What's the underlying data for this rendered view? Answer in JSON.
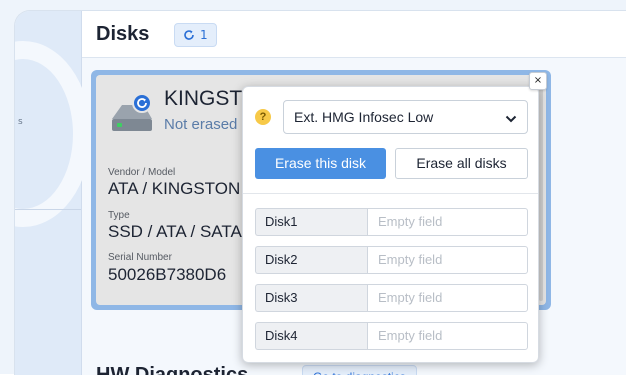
{
  "header": {
    "title": "Disks",
    "refresh_count": "1"
  },
  "disk": {
    "name": "KINGSTC",
    "status": "Not erased",
    "vendor_label": "Vendor / Model",
    "vendor_value": "ATA / KINGSTON",
    "type_label": "Type",
    "type_value": "SSD / ATA / SATA",
    "serial_label": "Serial Number",
    "serial_value": "50026B7380D6"
  },
  "popup": {
    "close_glyph": "×",
    "help_glyph": "?",
    "method_selected": "Ext. HMG Infosec Low",
    "erase_this_label": "Erase this disk",
    "erase_all_label": "Erase all disks",
    "rows": [
      {
        "label": "Disk1",
        "placeholder": "Empty field"
      },
      {
        "label": "Disk2",
        "placeholder": "Empty field"
      },
      {
        "label": "Disk3",
        "placeholder": "Empty field"
      },
      {
        "label": "Disk4",
        "placeholder": "Empty field"
      }
    ]
  },
  "section": {
    "hw_title": "HW Diagnostics",
    "diag_button": "Go to diagnostics"
  },
  "sidebar": {
    "collapse_glyph": "s"
  },
  "colors": {
    "accent": "#4a90e2",
    "card_border": "#8fb7e6",
    "status_text": "#5a7ca8"
  },
  "icons": {
    "refresh": "refresh-icon",
    "disk": "hard-disk-icon",
    "sync_badge": "sync-badge-icon",
    "chevron": "chevron-down-icon",
    "help": "help-icon",
    "close": "close-icon"
  }
}
